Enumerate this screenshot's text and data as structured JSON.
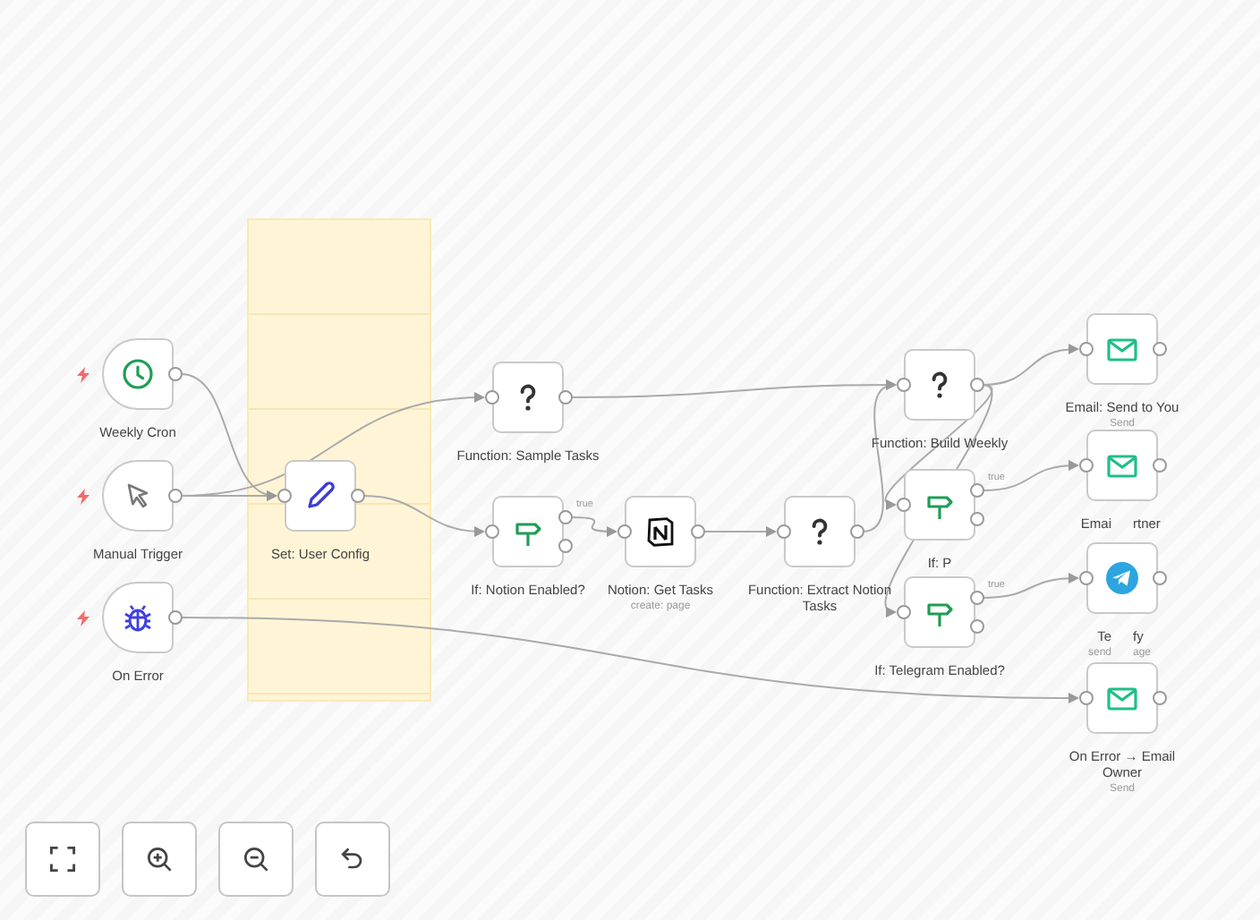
{
  "nodes": [
    {
      "kind": "cron",
      "label": "Weekly Cron"
    },
    {
      "kind": "manual",
      "label": "Manual Trigger"
    },
    {
      "kind": "error",
      "label": "On Error"
    },
    {
      "kind": "set",
      "label": "Set: User Config"
    },
    {
      "kind": "function",
      "label": "Function: Sample Tasks"
    },
    {
      "kind": "if",
      "label": "If: Notion Enabled?",
      "branch_label": "true"
    },
    {
      "kind": "notion",
      "label": "Notion: Get Tasks",
      "subtitle": "create: page"
    },
    {
      "kind": "function",
      "label": "Function: Extract Notion Tasks"
    },
    {
      "kind": "function",
      "label": "Function: Build Weekly"
    },
    {
      "kind": "if",
      "label": "If: P",
      "branch_label": "true"
    },
    {
      "kind": "if",
      "label": "If: Telegram Enabled?",
      "branch_label": "true"
    },
    {
      "kind": "email",
      "label": "Email: Send to You",
      "subtitle": "Send"
    },
    {
      "kind": "email",
      "label": "Emai",
      "label_tail": "rtner"
    },
    {
      "kind": "telegram",
      "label": "Te",
      "label_tail": "fy",
      "subtitle": "send",
      "subtitle_tail": "age"
    },
    {
      "kind": "email",
      "label": "On Error → Email Owner",
      "subtitle": "Send"
    }
  ],
  "controls": [
    {
      "kind": "fit"
    },
    {
      "kind": "zoom-in"
    },
    {
      "kind": "zoom-out"
    },
    {
      "kind": "undo"
    }
  ]
}
